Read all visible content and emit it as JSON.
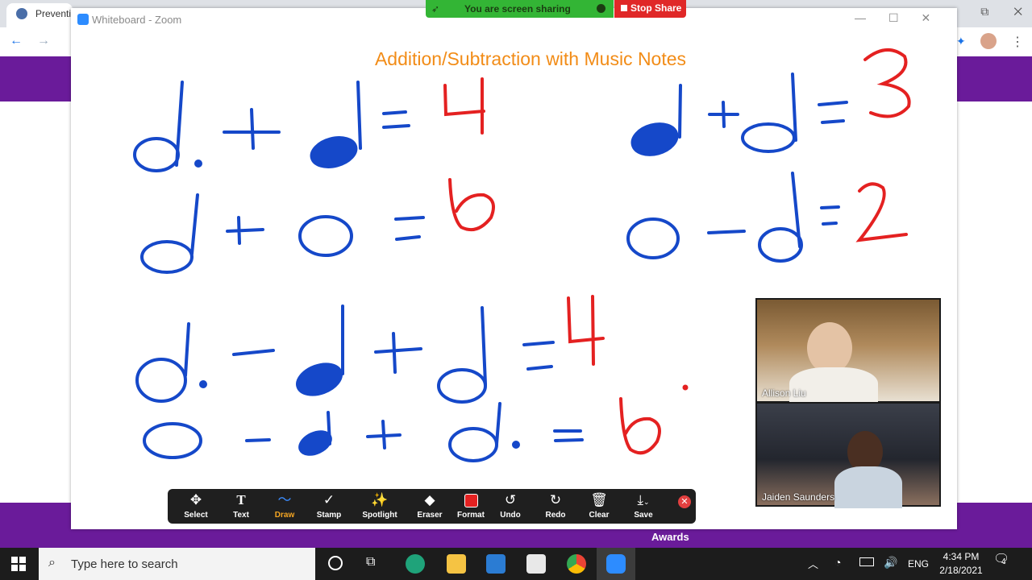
{
  "browser": {
    "tab_title": "Preventi",
    "accent": "#6a1b9a"
  },
  "page_behind": {
    "awards_label": "Awards"
  },
  "zoom": {
    "window_title": "Whiteboard - Zoom",
    "share_banner": "You are screen sharing",
    "stop_share": "Stop Share"
  },
  "whiteboard": {
    "title": "Addition/Subtraction with Music Notes",
    "answers": [
      "4",
      "3",
      "6",
      "2",
      "4",
      "6"
    ],
    "ink_blue": "#1548c9",
    "ink_red": "#e42121",
    "title_color": "#f28c17"
  },
  "participants": [
    {
      "name": "Allison Liu"
    },
    {
      "name": "Jaiden Saunders"
    }
  ],
  "toolbar": {
    "tools": [
      {
        "label": "Select",
        "icon": "move-icon"
      },
      {
        "label": "Text",
        "icon": "text-icon"
      },
      {
        "label": "Draw",
        "icon": "draw-icon"
      },
      {
        "label": "Stamp",
        "icon": "check-icon"
      },
      {
        "label": "Spotlight",
        "icon": "spotlight-icon"
      },
      {
        "label": "Eraser",
        "icon": "eraser-icon"
      },
      {
        "label": "Format",
        "icon": "format-icon"
      },
      {
        "label": "Undo",
        "icon": "undo-icon"
      },
      {
        "label": "Redo",
        "icon": "redo-icon"
      },
      {
        "label": "Clear",
        "icon": "trash-icon"
      },
      {
        "label": "Save",
        "icon": "save-icon"
      }
    ],
    "active_tool": "Draw"
  },
  "taskbar": {
    "search_placeholder": "Type here to search",
    "language": "ENG",
    "time": "4:34 PM",
    "date": "2/18/2021",
    "notification_count": "4"
  }
}
